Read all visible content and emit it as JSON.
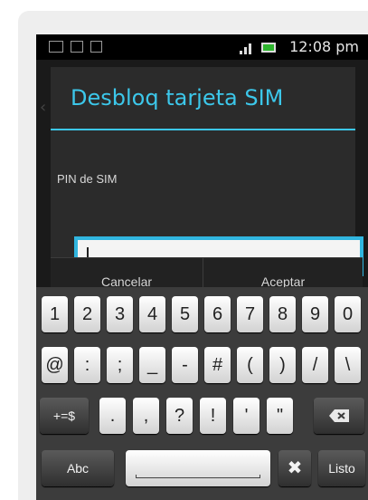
{
  "status_bar": {
    "time": "12:08 pm",
    "icons": [
      "keyboard-icon",
      "image-icon",
      "checkbox-icon",
      "signal-icon",
      "battery-icon"
    ]
  },
  "dialog": {
    "title": "Desbloq tarjeta SIM",
    "pin_label": "PIN de SIM",
    "pin_value": "",
    "cancel_label": "Cancelar",
    "accept_label": "Aceptar"
  },
  "keyboard": {
    "row1": [
      "1",
      "2",
      "3",
      "4",
      "5",
      "6",
      "7",
      "8",
      "9",
      "0"
    ],
    "row2": [
      "@",
      ":",
      ";",
      "_",
      "-",
      "#",
      "(",
      ")",
      "/",
      "\\"
    ],
    "row3": [
      "+=$",
      ".",
      ",",
      "?",
      "!",
      "'",
      "\"",
      "backspace"
    ],
    "row4": [
      "Abc",
      "space",
      "tools",
      "Listo"
    ]
  },
  "colors": {
    "accent": "#3cc7ea",
    "dialog_bg": "#2b2b2b",
    "screen_bg": "#1a1a1a",
    "keyboard_bg": "#3c3c3c"
  }
}
